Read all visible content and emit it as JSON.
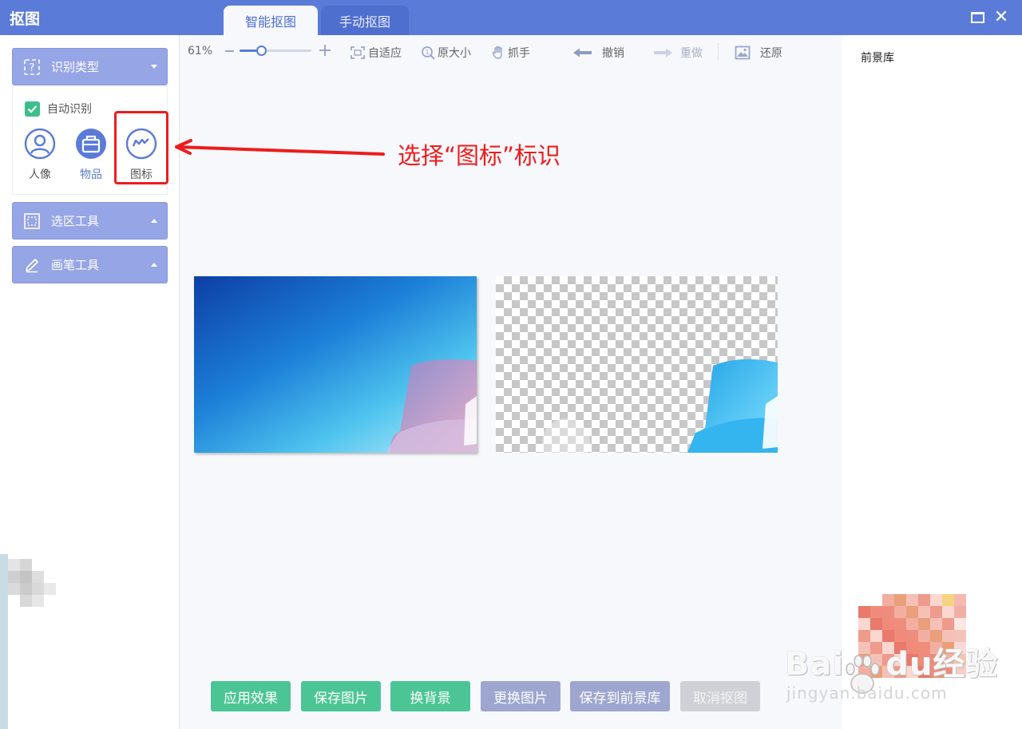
{
  "app": {
    "title": "抠图",
    "tabs": [
      {
        "label": "智能抠图",
        "active": true
      },
      {
        "label": "手动抠图",
        "active": false
      }
    ]
  },
  "left_panel": {
    "recognition": {
      "label": "识别类型",
      "auto_label": "自动识别",
      "auto_checked": true,
      "types": [
        {
          "label": "人像",
          "icon": "person-icon"
        },
        {
          "label": "物品",
          "icon": "bag-icon"
        },
        {
          "label": "图标",
          "icon": "logo-icon"
        }
      ]
    },
    "selection_tools": {
      "label": "选区工具"
    },
    "brush_tools": {
      "label": "画笔工具"
    }
  },
  "toolbar": {
    "zoom": "61%",
    "zoom_value": 0.3,
    "fit": "自适应",
    "original_size": "原大小",
    "hand": "抓手",
    "undo": "撤销",
    "redo": "重做",
    "restore": "还原"
  },
  "annotation": {
    "text": "选择“图标”标识",
    "color": "#ee1c1c"
  },
  "buttons": {
    "apply": "应用效果",
    "save_image": "保存图片",
    "change_bg": "换背景",
    "replace_image": "更换图片",
    "save_to_library": "保存到前景库",
    "cancel": "取消抠图"
  },
  "right_panel": {
    "title": "前景库"
  },
  "watermark": {
    "brand": "Bai",
    "brand_du": "du",
    "brand_cn": "经验",
    "url": "jingyan.baidu.com"
  },
  "colors": {
    "accent": "#5a7bd8",
    "section_header": "#96a5e5",
    "green_button": "#4cc596",
    "purple_button": "#9ea6cf",
    "disabled_button": "#cfd1d6"
  }
}
